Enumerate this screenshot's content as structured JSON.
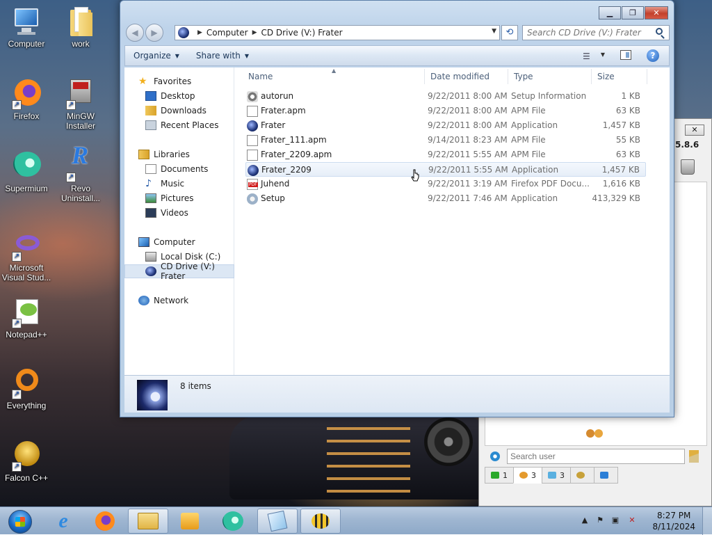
{
  "desktop": {
    "icons": [
      {
        "label": "Computer"
      },
      {
        "label": "work"
      },
      {
        "label": "Firefox"
      },
      {
        "label": "MinGW Installer"
      },
      {
        "label": "Supermium"
      },
      {
        "label": "Revo Uninstall..."
      },
      {
        "label": "Microsoft Visual Stud..."
      },
      {
        "label": "Notepad++"
      },
      {
        "label": "Everything"
      },
      {
        "label": "Falcon C++"
      }
    ]
  },
  "explorer": {
    "address": {
      "segments": [
        "Computer",
        "CD Drive (V:) Frater"
      ]
    },
    "search_placeholder": "Search CD Drive (V:) Frater",
    "commands": {
      "organize": "Organize",
      "share_with": "Share with"
    },
    "nav": {
      "favorites": "Favorites",
      "desktop": "Desktop",
      "downloads": "Downloads",
      "recent_places": "Recent Places",
      "libraries": "Libraries",
      "documents": "Documents",
      "music": "Music",
      "pictures": "Pictures",
      "videos": "Videos",
      "computer": "Computer",
      "local_disk": "Local Disk (C:)",
      "cd_drive": "CD Drive (V:) Frater",
      "network": "Network"
    },
    "columns": {
      "name": "Name",
      "date_modified": "Date modified",
      "type": "Type",
      "size": "Size"
    },
    "files": [
      {
        "name": "autorun",
        "date": "9/22/2011 8:00 AM",
        "type": "Setup Information",
        "size": "1 KB",
        "icon": "gear-doc-icon"
      },
      {
        "name": "Frater.apm",
        "date": "9/22/2011 8:00 AM",
        "type": "APM File",
        "size": "63 KB",
        "icon": "document-icon"
      },
      {
        "name": "Frater",
        "date": "9/22/2011 8:00 AM",
        "type": "Application",
        "size": "1,457 KB",
        "icon": "frater-app-icon"
      },
      {
        "name": "Frater_111.apm",
        "date": "9/14/2011 8:23 AM",
        "type": "APM File",
        "size": "55 KB",
        "icon": "document-icon"
      },
      {
        "name": "Frater_2209.apm",
        "date": "9/22/2011 5:55 AM",
        "type": "APM File",
        "size": "63 KB",
        "icon": "document-icon"
      },
      {
        "name": "Frater_2209",
        "date": "9/22/2011 5:55 AM",
        "type": "Application",
        "size": "1,457 KB",
        "icon": "frater-app-icon"
      },
      {
        "name": "Juhend",
        "date": "9/22/2011 3:19 AM",
        "type": "Firefox PDF Docu...",
        "size": "1,616 KB",
        "icon": "pdf-icon"
      },
      {
        "name": "Setup",
        "date": "9/22/2011 7:46 AM",
        "type": "Application",
        "size": "413,329 KB",
        "icon": "setup-icon"
      }
    ],
    "status": {
      "item_count": "8 items"
    }
  },
  "side_app": {
    "version": "5.8.6",
    "search_placeholder": "Search user",
    "tabs": [
      {
        "label": "1"
      },
      {
        "label": "3"
      },
      {
        "label": "3"
      },
      {
        "label": ""
      },
      {
        "label": ""
      }
    ]
  },
  "taskbar": {
    "time": "8:27 PM",
    "date": "8/11/2024"
  }
}
